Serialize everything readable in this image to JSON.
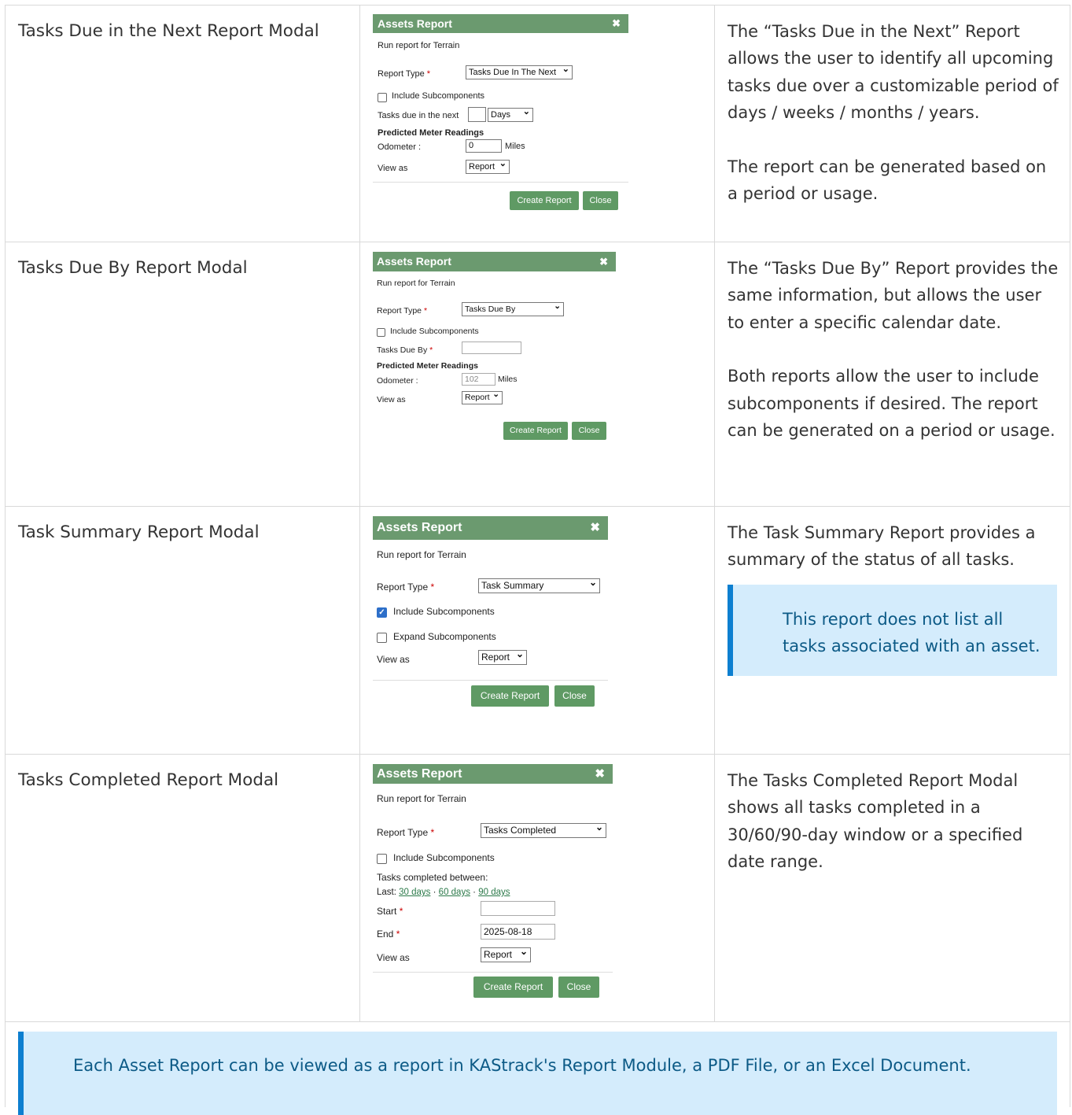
{
  "rows": [
    {
      "label": "Tasks Due in the Next Report Modal",
      "desc": [
        "The “Tasks Due in the Next” Report allows the user to identify all upcoming tasks due over a customizable period of days / weeks / months / years.",
        "The report can be generated based on a period or usage."
      ],
      "modal": {
        "title": "Assets Report",
        "close_icon": "✖",
        "subtitle": "Run report for Terrain",
        "report_type_label": "Report Type",
        "report_type_value": "Tasks Due In The Next",
        "include_sub": "Include Subcomponents",
        "tasks_label": "Tasks due in the next",
        "period_value": "Days",
        "meter_heading": "Predicted Meter Readings",
        "odometer_label": "Odometer :",
        "odometer_value": "0",
        "unit": "Miles",
        "view_label": "View as",
        "view_value": "Report",
        "create": "Create Report",
        "close": "Close"
      }
    },
    {
      "label": "Tasks Due By Report Modal",
      "desc": [
        "The “Tasks Due By” Report provides the same information, but allows the user to enter a specific calendar date.",
        "Both reports allow the user to include subcomponents if desired. The report can be generated on a period or usage."
      ],
      "modal": {
        "title": "Assets Report",
        "close_icon": "✖",
        "subtitle": "Run report for Terrain",
        "report_type_label": "Report Type",
        "report_type_value": "Tasks Due By",
        "include_sub": "Include Subcomponents",
        "tasks_label": "Tasks Due By",
        "meter_heading": "Predicted Meter Readings",
        "odometer_label": "Odometer :",
        "odometer_value": "102",
        "unit": "Miles",
        "view_label": "View as",
        "view_value": "Report",
        "create": "Create Report",
        "close": "Close"
      }
    },
    {
      "label": "Task Summary Report Modal",
      "desc": [
        "The Task Summary Report provides a summary of the status of all tasks."
      ],
      "callout": "This report does not list all tasks associated with an asset.",
      "modal": {
        "title": "Assets Report",
        "close_icon": "✖",
        "subtitle": "Run report for Terrain",
        "report_type_label": "Report Type",
        "report_type_value": "Task Summary",
        "include_sub": "Include Subcomponents",
        "check_mark": "✓",
        "expand_sub": "Expand Subcomponents",
        "view_label": "View as",
        "view_value": "Report",
        "create": "Create Report",
        "close": "Close"
      }
    },
    {
      "label": "Tasks Completed Report Modal",
      "desc": [
        "The Tasks Completed Report Modal shows all tasks completed in a 30/60/90-day window or a specified date range."
      ],
      "modal": {
        "title": "Assets Report",
        "close_icon": "✖",
        "subtitle": "Run report for Terrain",
        "report_type_label": "Report Type",
        "report_type_value": "Tasks Completed",
        "include_sub": "Include Subcomponents",
        "between_label": "Tasks completed between:",
        "last_label": "Last:",
        "link_30": "30 days",
        "link_60": "60 days",
        "link_90": "90 days",
        "dot": "·",
        "start_label": "Start",
        "end_label": "End",
        "end_value": "2025-08-18",
        "view_label": "View as",
        "view_value": "Report",
        "create": "Create Report",
        "close": "Close"
      }
    }
  ],
  "footer_note": "Each Asset Report can be viewed as a report in KAStrack's Report Module, a PDF File, or an Excel Document.",
  "required_mark": "*"
}
